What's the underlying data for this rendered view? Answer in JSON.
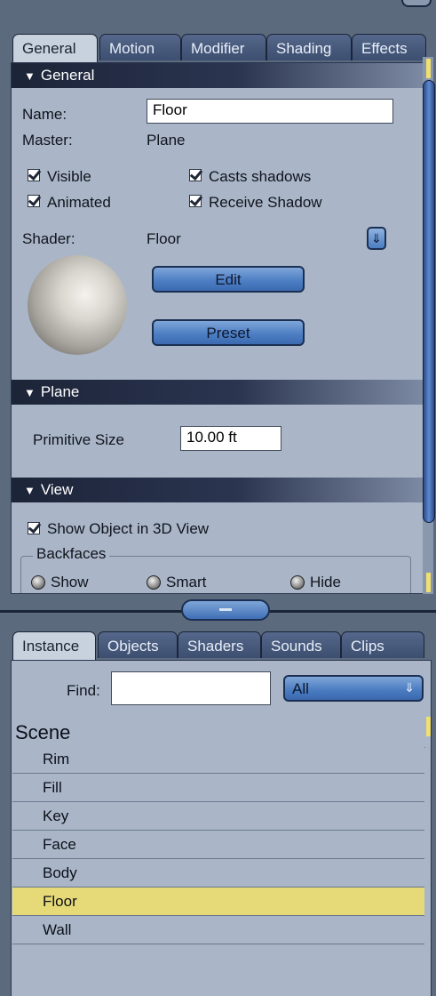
{
  "properties_panel": {
    "tabs": [
      "General",
      "Motion",
      "Modifier",
      "Shading",
      "Effects"
    ],
    "active_tab": "General",
    "sections": {
      "general": {
        "header": "General",
        "name_label": "Name:",
        "name_value": "Floor",
        "master_label": "Master:",
        "master_value": "Plane",
        "checkboxes": {
          "visible": "Visible",
          "casts_shadows": "Casts shadows",
          "animated": "Animated",
          "receive_shadow": "Receive Shadow"
        },
        "shader_label": "Shader:",
        "shader_value": "Floor",
        "edit_button": "Edit",
        "preset_button": "Preset"
      },
      "plane": {
        "header": "Plane",
        "primitive_size_label": "Primitive Size",
        "primitive_size_value": "10.00 ft"
      },
      "view": {
        "header": "View",
        "show_object_label": "Show Object in 3D View",
        "backfaces_label": "Backfaces",
        "backface_options": [
          "Show",
          "Smart",
          "Hide"
        ]
      }
    }
  },
  "library_panel": {
    "tabs": [
      "Instance",
      "Objects",
      "Shaders",
      "Sounds",
      "Clips"
    ],
    "active_tab": "Instance",
    "find_label": "Find:",
    "find_value": "",
    "filter_value": "All",
    "scene_header": "Scene",
    "items": [
      "Rim",
      "Fill",
      "Key",
      "Face",
      "Body",
      "Floor",
      "Wall"
    ],
    "selected_item": "Floor"
  },
  "colors": {
    "panel_bg": "#aab6c8",
    "accent_blue": "#4e7fc4",
    "selected_row": "#e6da78",
    "header_dark": "#1c2438"
  }
}
